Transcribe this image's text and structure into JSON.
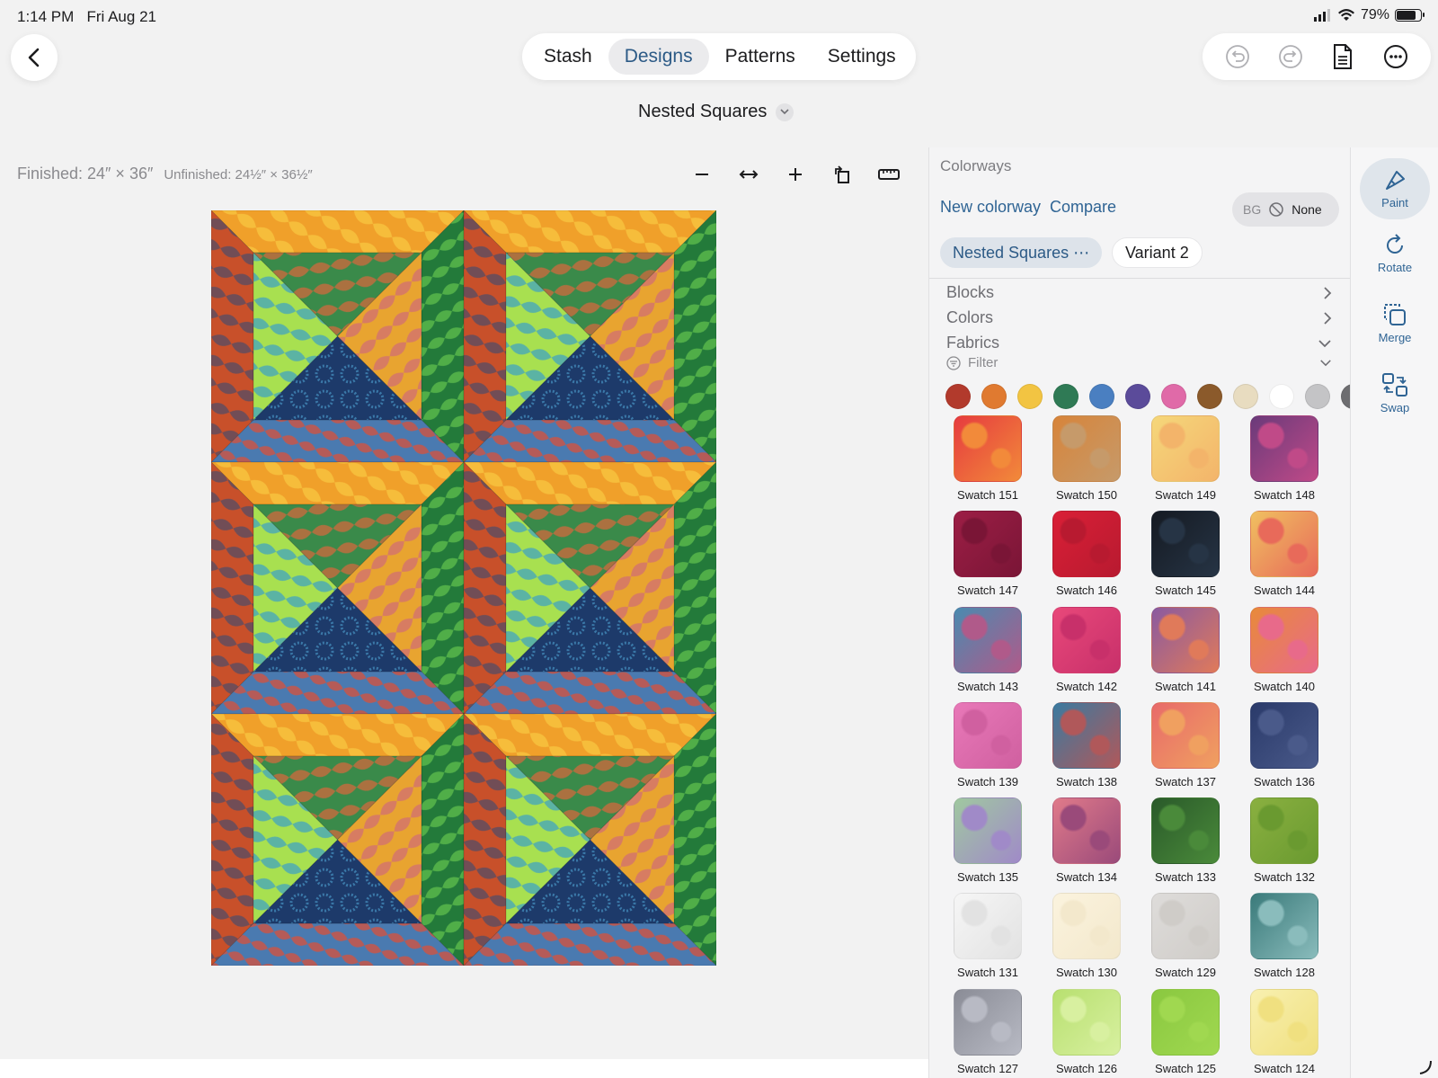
{
  "status": {
    "time": "1:14 PM",
    "date": "Fri Aug 21",
    "battery": "79%",
    "battery_level": 0.79
  },
  "tabs": [
    {
      "label": "Stash",
      "active": false
    },
    {
      "label": "Designs",
      "active": true
    },
    {
      "label": "Patterns",
      "active": false
    },
    {
      "label": "Settings",
      "active": false
    }
  ],
  "toolbar": {
    "icons": [
      "undo-icon",
      "redo-icon",
      "document-icon",
      "more-icon"
    ]
  },
  "design": {
    "title": "Nested Squares"
  },
  "dimensions": {
    "finished": "Finished: 24″ × 36″",
    "unfinished": "Unfinished: 24½″ × 36½″"
  },
  "canvas_tools": [
    "zoom-out-icon",
    "fit-width-icon",
    "zoom-in-icon",
    "rotate-canvas-icon",
    "ruler-icon"
  ],
  "panel": {
    "title": "Colorways",
    "new_colorway": "New colorway",
    "compare": "Compare",
    "bg_label": "BG",
    "bg_value": "None",
    "colorways": [
      {
        "label": "Nested Squares ⋯",
        "active": true
      },
      {
        "label": "Variant 2",
        "active": false
      }
    ],
    "sections": {
      "blocks": "Blocks",
      "colors": "Colors",
      "fabrics": "Fabrics",
      "filter": "Filter"
    },
    "filter_colors": [
      "#b23a2c",
      "#e07a30",
      "#f2c442",
      "#2f7a55",
      "#4a7fc1",
      "#5b4b9a",
      "#e06aa8",
      "#8b5a2b",
      "#e8dcc0",
      "#ffffff",
      "#c4c4c6",
      "#6d6d70"
    ],
    "swatches": [
      {
        "label": "Swatch 151",
        "c1": "#e63b3f",
        "c2": "#f28a3a"
      },
      {
        "label": "Swatch 150",
        "c1": "#d7843a",
        "c2": "#c69a6a"
      },
      {
        "label": "Swatch 149",
        "c1": "#f5d77a",
        "c2": "#f3b46a"
      },
      {
        "label": "Swatch 148",
        "c1": "#6a3a7a",
        "c2": "#c04a88"
      },
      {
        "label": "Swatch 147",
        "c1": "#9c1e45",
        "c2": "#7a1536"
      },
      {
        "label": "Swatch 146",
        "c1": "#d91f36",
        "c2": "#b81a30"
      },
      {
        "label": "Swatch 145",
        "c1": "#151a22",
        "c2": "#263445"
      },
      {
        "label": "Swatch 144",
        "c1": "#f0c060",
        "c2": "#e86a5a"
      },
      {
        "label": "Swatch 143",
        "c1": "#4a8ab0",
        "c2": "#b05a8a"
      },
      {
        "label": "Swatch 142",
        "c1": "#e8487a",
        "c2": "#c8306a"
      },
      {
        "label": "Swatch 141",
        "c1": "#8a5aa0",
        "c2": "#e07a5a"
      },
      {
        "label": "Swatch 140",
        "c1": "#e88a3a",
        "c2": "#e86a8a"
      },
      {
        "label": "Swatch 139",
        "c1": "#e878b8",
        "c2": "#d060a0"
      },
      {
        "label": "Swatch 138",
        "c1": "#3a7aa0",
        "c2": "#b0585a"
      },
      {
        "label": "Swatch 137",
        "c1": "#e86a6a",
        "c2": "#f0a060"
      },
      {
        "label": "Swatch 136",
        "c1": "#2a3a6a",
        "c2": "#4a5a8a"
      },
      {
        "label": "Swatch 135",
        "c1": "#a0c8a0",
        "c2": "#a08ac8"
      },
      {
        "label": "Swatch 134",
        "c1": "#e07a8a",
        "c2": "#9a4a7a"
      },
      {
        "label": "Swatch 133",
        "c1": "#2a5a2a",
        "c2": "#4a8a3a"
      },
      {
        "label": "Swatch 132",
        "c1": "#8ab040",
        "c2": "#6a9a30"
      },
      {
        "label": "Swatch 131",
        "c1": "#f6f6f6",
        "c2": "#e2e2e2"
      },
      {
        "label": "Swatch 130",
        "c1": "#fbf3de",
        "c2": "#f3e8cc"
      },
      {
        "label": "Swatch 129",
        "c1": "#dedcda",
        "c2": "#cfccc8"
      },
      {
        "label": "Swatch 128",
        "c1": "#3a7a7a",
        "c2": "#8abcbc"
      },
      {
        "label": "Swatch 127",
        "c1": "#8a8c96",
        "c2": "#b8bac4"
      },
      {
        "label": "Swatch 126",
        "c1": "#b8e070",
        "c2": "#d8f0a0"
      },
      {
        "label": "Swatch 125",
        "c1": "#8ac840",
        "c2": "#a0d850"
      },
      {
        "label": "Swatch 124",
        "c1": "#f8f0b0",
        "c2": "#f0e080"
      }
    ]
  },
  "side_tools": [
    {
      "label": "Paint",
      "icon": "paintbrush-icon",
      "active": true
    },
    {
      "label": "Rotate",
      "icon": "rotate-icon",
      "active": false
    },
    {
      "label": "Merge",
      "icon": "merge-icon",
      "active": false
    },
    {
      "label": "Swap",
      "icon": "swap-icon",
      "active": false
    }
  ],
  "colors": {
    "accent": "#2f6494",
    "orange": "#f0a02a",
    "navy": "#1d3a6a",
    "lime": "#a8e050",
    "green": "#2e8a3a",
    "rust": "#c8502a"
  }
}
